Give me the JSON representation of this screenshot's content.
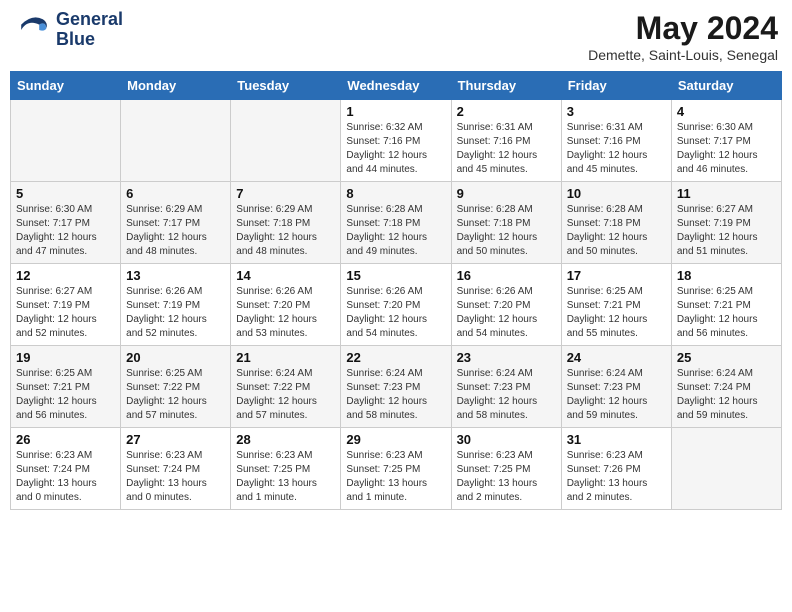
{
  "header": {
    "logo_line1": "General",
    "logo_line2": "Blue",
    "month": "May 2024",
    "location": "Demette, Saint-Louis, Senegal"
  },
  "weekdays": [
    "Sunday",
    "Monday",
    "Tuesday",
    "Wednesday",
    "Thursday",
    "Friday",
    "Saturday"
  ],
  "weeks": [
    [
      {
        "day": "",
        "info": ""
      },
      {
        "day": "",
        "info": ""
      },
      {
        "day": "",
        "info": ""
      },
      {
        "day": "1",
        "info": "Sunrise: 6:32 AM\nSunset: 7:16 PM\nDaylight: 12 hours\nand 44 minutes."
      },
      {
        "day": "2",
        "info": "Sunrise: 6:31 AM\nSunset: 7:16 PM\nDaylight: 12 hours\nand 45 minutes."
      },
      {
        "day": "3",
        "info": "Sunrise: 6:31 AM\nSunset: 7:16 PM\nDaylight: 12 hours\nand 45 minutes."
      },
      {
        "day": "4",
        "info": "Sunrise: 6:30 AM\nSunset: 7:17 PM\nDaylight: 12 hours\nand 46 minutes."
      }
    ],
    [
      {
        "day": "5",
        "info": "Sunrise: 6:30 AM\nSunset: 7:17 PM\nDaylight: 12 hours\nand 47 minutes."
      },
      {
        "day": "6",
        "info": "Sunrise: 6:29 AM\nSunset: 7:17 PM\nDaylight: 12 hours\nand 48 minutes."
      },
      {
        "day": "7",
        "info": "Sunrise: 6:29 AM\nSunset: 7:18 PM\nDaylight: 12 hours\nand 48 minutes."
      },
      {
        "day": "8",
        "info": "Sunrise: 6:28 AM\nSunset: 7:18 PM\nDaylight: 12 hours\nand 49 minutes."
      },
      {
        "day": "9",
        "info": "Sunrise: 6:28 AM\nSunset: 7:18 PM\nDaylight: 12 hours\nand 50 minutes."
      },
      {
        "day": "10",
        "info": "Sunrise: 6:28 AM\nSunset: 7:18 PM\nDaylight: 12 hours\nand 50 minutes."
      },
      {
        "day": "11",
        "info": "Sunrise: 6:27 AM\nSunset: 7:19 PM\nDaylight: 12 hours\nand 51 minutes."
      }
    ],
    [
      {
        "day": "12",
        "info": "Sunrise: 6:27 AM\nSunset: 7:19 PM\nDaylight: 12 hours\nand 52 minutes."
      },
      {
        "day": "13",
        "info": "Sunrise: 6:26 AM\nSunset: 7:19 PM\nDaylight: 12 hours\nand 52 minutes."
      },
      {
        "day": "14",
        "info": "Sunrise: 6:26 AM\nSunset: 7:20 PM\nDaylight: 12 hours\nand 53 minutes."
      },
      {
        "day": "15",
        "info": "Sunrise: 6:26 AM\nSunset: 7:20 PM\nDaylight: 12 hours\nand 54 minutes."
      },
      {
        "day": "16",
        "info": "Sunrise: 6:26 AM\nSunset: 7:20 PM\nDaylight: 12 hours\nand 54 minutes."
      },
      {
        "day": "17",
        "info": "Sunrise: 6:25 AM\nSunset: 7:21 PM\nDaylight: 12 hours\nand 55 minutes."
      },
      {
        "day": "18",
        "info": "Sunrise: 6:25 AM\nSunset: 7:21 PM\nDaylight: 12 hours\nand 56 minutes."
      }
    ],
    [
      {
        "day": "19",
        "info": "Sunrise: 6:25 AM\nSunset: 7:21 PM\nDaylight: 12 hours\nand 56 minutes."
      },
      {
        "day": "20",
        "info": "Sunrise: 6:25 AM\nSunset: 7:22 PM\nDaylight: 12 hours\nand 57 minutes."
      },
      {
        "day": "21",
        "info": "Sunrise: 6:24 AM\nSunset: 7:22 PM\nDaylight: 12 hours\nand 57 minutes."
      },
      {
        "day": "22",
        "info": "Sunrise: 6:24 AM\nSunset: 7:23 PM\nDaylight: 12 hours\nand 58 minutes."
      },
      {
        "day": "23",
        "info": "Sunrise: 6:24 AM\nSunset: 7:23 PM\nDaylight: 12 hours\nand 58 minutes."
      },
      {
        "day": "24",
        "info": "Sunrise: 6:24 AM\nSunset: 7:23 PM\nDaylight: 12 hours\nand 59 minutes."
      },
      {
        "day": "25",
        "info": "Sunrise: 6:24 AM\nSunset: 7:24 PM\nDaylight: 12 hours\nand 59 minutes."
      }
    ],
    [
      {
        "day": "26",
        "info": "Sunrise: 6:23 AM\nSunset: 7:24 PM\nDaylight: 13 hours\nand 0 minutes."
      },
      {
        "day": "27",
        "info": "Sunrise: 6:23 AM\nSunset: 7:24 PM\nDaylight: 13 hours\nand 0 minutes."
      },
      {
        "day": "28",
        "info": "Sunrise: 6:23 AM\nSunset: 7:25 PM\nDaylight: 13 hours\nand 1 minute."
      },
      {
        "day": "29",
        "info": "Sunrise: 6:23 AM\nSunset: 7:25 PM\nDaylight: 13 hours\nand 1 minute."
      },
      {
        "day": "30",
        "info": "Sunrise: 6:23 AM\nSunset: 7:25 PM\nDaylight: 13 hours\nand 2 minutes."
      },
      {
        "day": "31",
        "info": "Sunrise: 6:23 AM\nSunset: 7:26 PM\nDaylight: 13 hours\nand 2 minutes."
      },
      {
        "day": "",
        "info": ""
      }
    ]
  ]
}
